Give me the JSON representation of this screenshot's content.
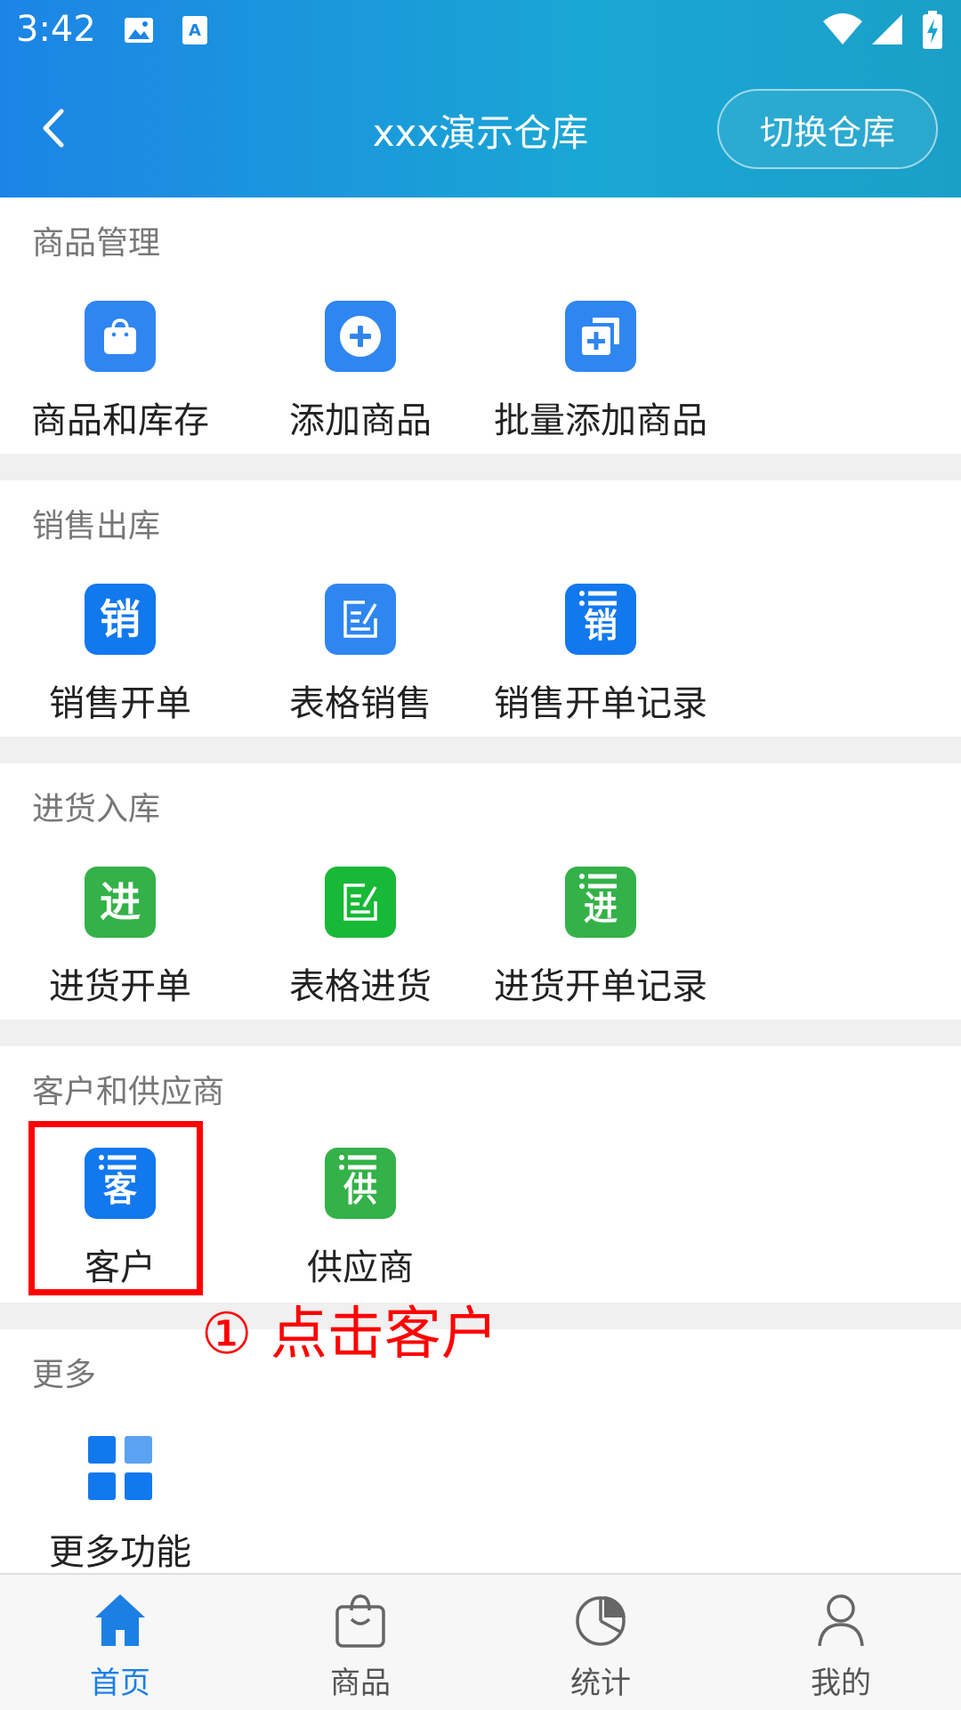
{
  "statusbar": {
    "time": "3:42"
  },
  "header": {
    "title": "xxx演示仓库",
    "switch_label": "切换仓库"
  },
  "sections": {
    "goods": {
      "title": "商品管理",
      "items": [
        {
          "label": "商品和库存",
          "icon": "shopping-bag-icon"
        },
        {
          "label": "添加商品",
          "icon": "plus-circle-icon"
        },
        {
          "label": "批量添加商品",
          "icon": "batch-add-icon"
        }
      ]
    },
    "sales": {
      "title": "销售出库",
      "items": [
        {
          "label": "销售开单",
          "icon_char": "销"
        },
        {
          "label": "表格销售",
          "icon": "form-edit-icon"
        },
        {
          "label": "销售开单记录",
          "icon_char": "销"
        }
      ]
    },
    "purchase": {
      "title": "进货入库",
      "items": [
        {
          "label": "进货开单",
          "icon_char": "进"
        },
        {
          "label": "表格进货",
          "icon": "form-edit-icon"
        },
        {
          "label": "进货开单记录",
          "icon_char": "进"
        }
      ]
    },
    "partners": {
      "title": "客户和供应商",
      "items": [
        {
          "label": "客户",
          "icon_char": "客"
        },
        {
          "label": "供应商",
          "icon_char": "供"
        }
      ]
    },
    "more": {
      "title": "更多",
      "items": [
        {
          "label": "更多功能",
          "icon": "grid-icon"
        }
      ]
    }
  },
  "annotation": {
    "text": "① 点击客户",
    "color": "#ff0000"
  },
  "bottom_nav": [
    {
      "label": "首页",
      "icon": "home-icon",
      "active": true
    },
    {
      "label": "商品",
      "icon": "shopping-bag-icon"
    },
    {
      "label": "统计",
      "icon": "pie-chart-icon"
    },
    {
      "label": "我的",
      "icon": "user-icon"
    }
  ],
  "colors": {
    "accent_blue": "#2f86f0",
    "accent_green": "#34b148",
    "active_nav": "#1c7fe4"
  }
}
